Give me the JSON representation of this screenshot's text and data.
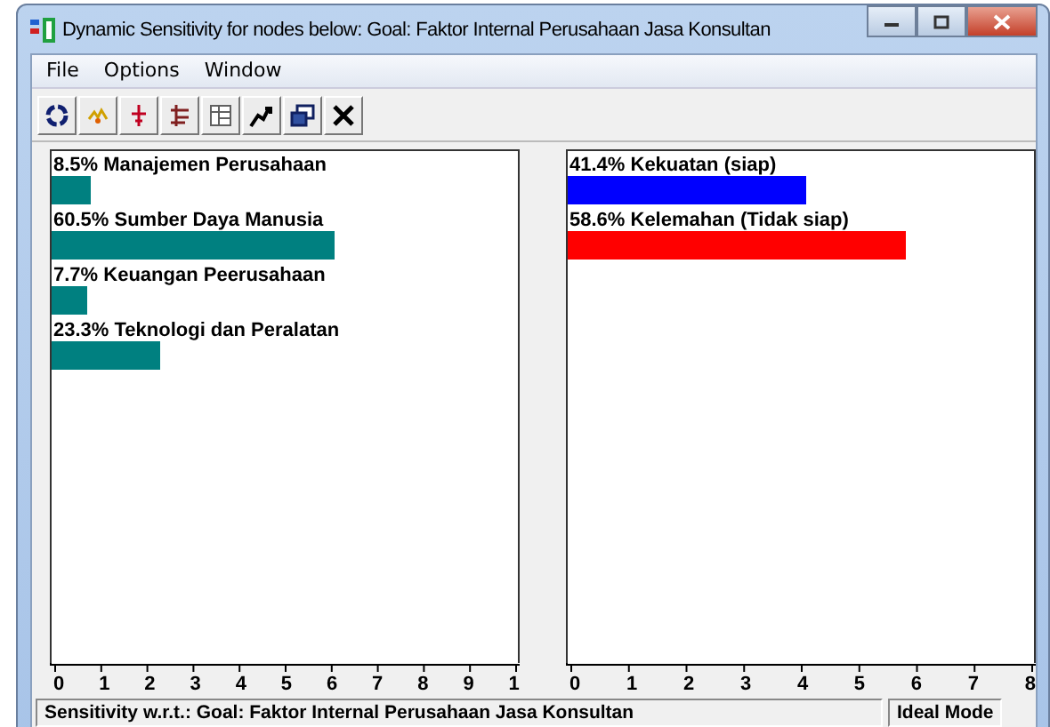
{
  "window": {
    "title": "Dynamic Sensitivity for nodes below: Goal: Faktor Internal Perusahaan Jasa Konsultan"
  },
  "menu": [
    "File",
    "Options",
    "Window"
  ],
  "toolbar": [
    {
      "kind": "cycle"
    },
    {
      "kind": "burst"
    },
    {
      "kind": "cross"
    },
    {
      "kind": "branch"
    },
    {
      "kind": "grid"
    },
    {
      "kind": "arrow"
    },
    {
      "kind": "windows"
    },
    {
      "kind": "close"
    }
  ],
  "left_panel": {
    "bars": [
      {
        "label": "8.5% Manajemen Perusahaan",
        "level": 0.085,
        "color": "#008080"
      },
      {
        "label": "60.5% Sumber Daya Manusia",
        "level": 0.605,
        "color": "#008080"
      },
      {
        "label": "7.7% Keuangan Peerusahaan",
        "level": 0.077,
        "color": "#008080"
      },
      {
        "label": "23.3% Teknologi dan Peralatan",
        "level": 0.233,
        "color": "#008080"
      }
    ],
    "axis_labels": [
      "0",
      "1",
      "2",
      "3",
      "4",
      "5",
      "6",
      "7",
      "8",
      "9",
      "1"
    ]
  },
  "right_panel": {
    "bars": [
      {
        "label": "41.4% Kekuatan (siap)",
        "level": 0.51,
        "color": "#0000ff"
      },
      {
        "label": "58.6% Kelemahan (Tidak siap)",
        "level": 0.725,
        "color": "#ff0000"
      }
    ],
    "axis_labels": [
      "0",
      "1",
      "2",
      "3",
      "4",
      "5",
      "6",
      "7",
      "8"
    ]
  },
  "status_bar": {
    "text": "Sensitivity w.r.t.: Goal: Faktor Internal Perusahaan Jasa Konsultan",
    "mode": "Ideal Mode"
  }
}
